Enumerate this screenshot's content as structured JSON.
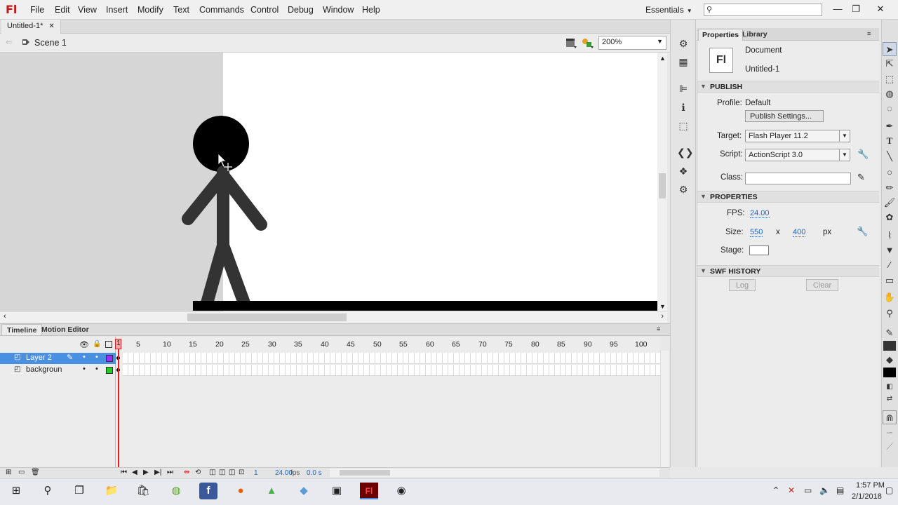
{
  "app": {
    "logo": "Fl",
    "menus": [
      "File",
      "Edit",
      "View",
      "Insert",
      "Modify",
      "Text",
      "Commands",
      "Control",
      "Debug",
      "Window",
      "Help"
    ],
    "workspace": "Essentials"
  },
  "document": {
    "tab_title": "Untitled-1*",
    "scene": "Scene 1",
    "zoom": "200%"
  },
  "properties": {
    "tabs": [
      "Properties",
      "Library"
    ],
    "doc_type": "Document",
    "doc_name": "Untitled-1",
    "doc_icon": "Fl",
    "publish": {
      "header": "PUBLISH",
      "profile_label": "Profile:",
      "profile_value": "Default",
      "settings_button": "Publish Settings...",
      "target_label": "Target:",
      "target_value": "Flash Player 11.2",
      "script_label": "Script:",
      "script_value": "ActionScript 3.0",
      "class_label": "Class:"
    },
    "props": {
      "header": "PROPERTIES",
      "fps_label": "FPS:",
      "fps_value": "24.00",
      "size_label": "Size:",
      "width": "550",
      "x_sep": "x",
      "height": "400",
      "unit": "px",
      "stage_label": "Stage:",
      "stage_color": "#ffffff"
    },
    "swf_history": {
      "header": "SWF HISTORY",
      "log_button": "Log",
      "clear_button": "Clear"
    }
  },
  "timeline": {
    "tabs": [
      "Timeline",
      "Motion Editor"
    ],
    "ruler_labels": [
      "1",
      "5",
      "10",
      "15",
      "20",
      "25",
      "30",
      "35",
      "40",
      "45",
      "50",
      "55",
      "60",
      "65",
      "70",
      "75",
      "80",
      "85",
      "90",
      "95",
      "100"
    ],
    "layers": [
      {
        "name": "Layer 2",
        "color": "#9b30ff"
      },
      {
        "name": "backgroun",
        "color": "#22cc22"
      }
    ],
    "footer": {
      "current_frame": "1",
      "fps": "24.00",
      "fps_unit": "fps",
      "time": "0.0 s"
    }
  },
  "taskbar": {
    "time": "1:57 PM",
    "date": "2/1/2018"
  },
  "colors": {
    "accent": "#4a90e2",
    "playhead": "#e02020",
    "logo_red": "#c01818"
  }
}
